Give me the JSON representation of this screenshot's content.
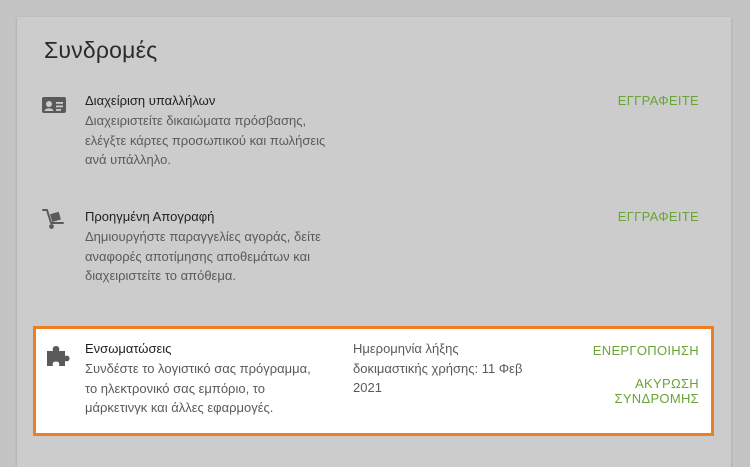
{
  "page": {
    "title": "Συνδρομές"
  },
  "subscriptions": [
    {
      "icon": "id-card-icon",
      "name": "Διαχείριση υπαλλήλων",
      "description": "Διαχειριστείτε δικαιώματα πρόσβασης, ελέγξτε κάρτες προσωπικού και πωλήσεις ανά υπάλληλο.",
      "action": "ΕΓΓΡΑΦΕΙΤΕ"
    },
    {
      "icon": "hand-truck-icon",
      "name": "Προηγμένη Απογραφή",
      "description": "Δημιουργήστε παραγγελίες αγοράς, δείτε αναφορές αποτίμησης αποθεμάτων και διαχειριστείτε το απόθεμα.",
      "action": "ΕΓΓΡΑΦΕΙΤΕ"
    },
    {
      "icon": "puzzle-piece-icon",
      "name": "Ενσωματώσεις",
      "description": "Συνδέστε το λογιστικό σας πρόγραμμα, το ηλεκτρονικό σας εμπόριο, το μάρκετινγκ και άλλες εφαρμογές.",
      "trial_text": "Ημερομηνία λήξης δοκιμαστικής χρήσης: 11 Φεβ 2021",
      "action": "ΕΝΕΡΓΟΠΟΙΗΣΗ",
      "secondary_action": "ΑΚΥΡΩΣΗ ΣΥΝΔΡΟΜΗΣ"
    }
  ],
  "colors": {
    "action": "#6aa336",
    "highlight_border": "#ef7d22",
    "overlay_background": "#cccccc"
  }
}
